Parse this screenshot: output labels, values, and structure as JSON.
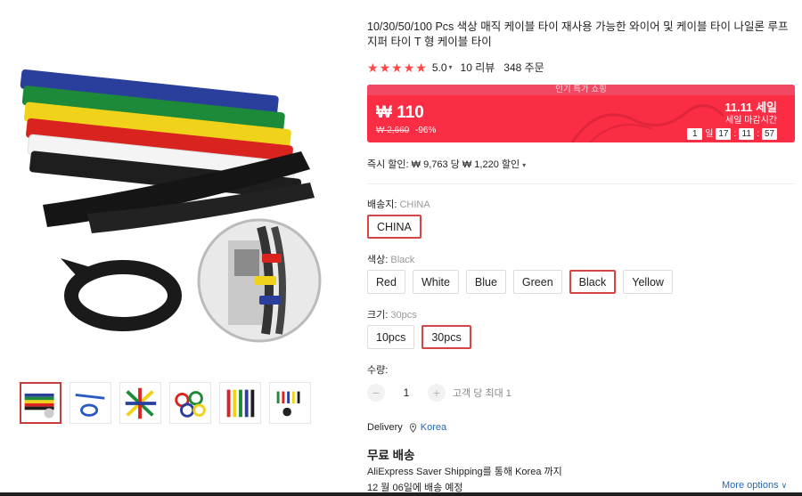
{
  "product": {
    "title": "10/30/50/100 Pcs 색상 매직 케이블 타이 재사용 가능한 와이어 및 케이블 타이 나일론 루프 지퍼 타이 T 형 케이블 타이",
    "rating": "5.0",
    "rating_stars": 5,
    "reviews": "10 리뷰",
    "orders": "348 주문"
  },
  "banner": {
    "header": "인기 특가 쇼핑",
    "price": "₩ 110",
    "original_price": "₩ 2,660",
    "discount": "-96%",
    "sale_title": "11.11 세일",
    "sale_subtitle": "세일 마감시간",
    "countdown": {
      "days": "1",
      "days_label": "일",
      "hours": "17",
      "minutes": "11",
      "seconds": "57"
    },
    "colors": {
      "background": "#fa2d45",
      "header": "#f04862"
    }
  },
  "instant_discount": "즉시 할인: ₩ 9,763 당 ₩ 1,220 할인",
  "ship_from": {
    "label": "배송지:",
    "value": "CHINA",
    "options": [
      "CHINA"
    ]
  },
  "color": {
    "label": "색상:",
    "value": "Black",
    "options": [
      "Red",
      "White",
      "Blue",
      "Green",
      "Black",
      "Yellow"
    ]
  },
  "size": {
    "label": "크기:",
    "value": "30pcs",
    "options": [
      "10pcs",
      "30pcs"
    ]
  },
  "quantity": {
    "label": "수량:",
    "minus": "−",
    "plus": "+",
    "value": "1",
    "limit": "고객 당 최대 1"
  },
  "delivery": {
    "label": "Delivery",
    "location": "Korea",
    "free_shipping": "무료 배송",
    "method": "AliExpress Saver Shipping를 통해 Korea 까지",
    "date": "12 월 06일에 배송 예정",
    "more_options": "More options"
  },
  "icons": {
    "rating_caret": "chevron-down-icon",
    "location": "location-pin-icon",
    "more_options": "chevron-down-icon"
  },
  "colors": {
    "accent": "#ff4747",
    "selected_border": "#d64545",
    "link": "#2468b5"
  },
  "gallery": {
    "thumbnail_count": 6,
    "active_index": 0
  }
}
